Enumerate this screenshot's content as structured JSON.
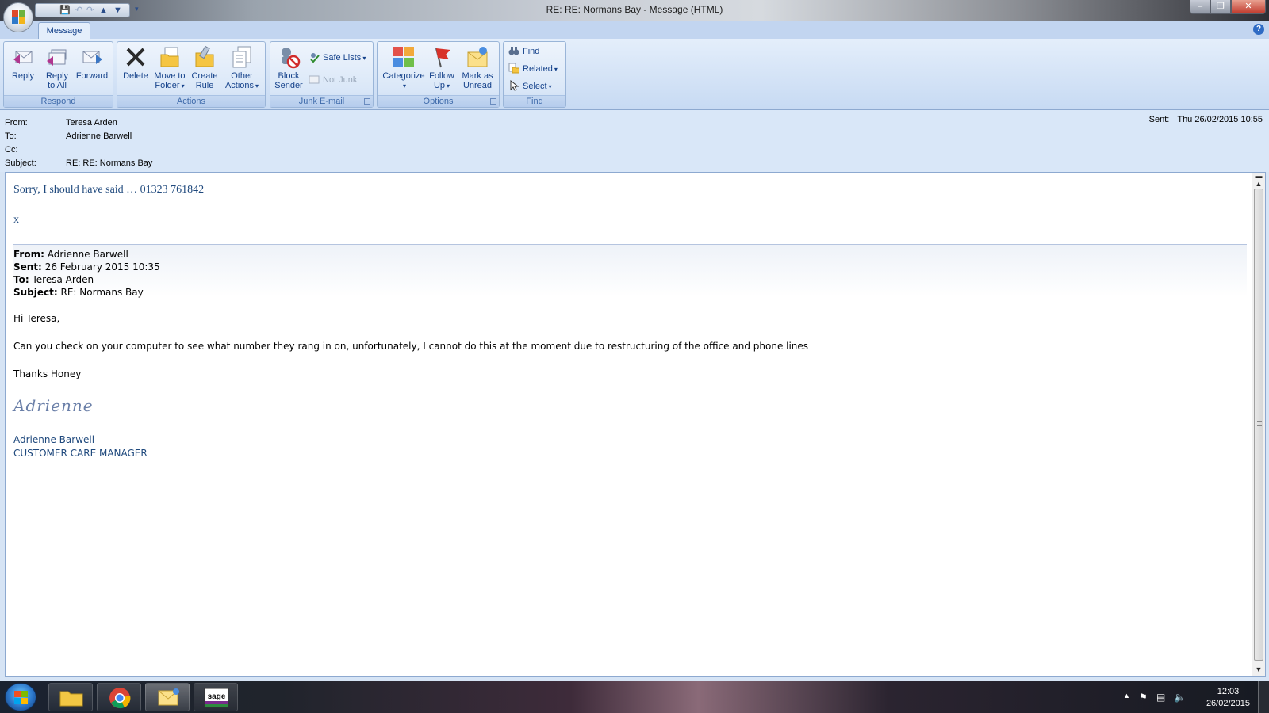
{
  "window": {
    "title": "RE: RE: Normans Bay - Message (HTML)",
    "minimize": "–",
    "maximize": "❐",
    "close": "✕"
  },
  "ribbon": {
    "tab": "Message",
    "help": "?",
    "groups": {
      "respond": {
        "label": "Respond",
        "reply": [
          "Reply",
          ""
        ],
        "reply_all": [
          "Reply",
          "to All"
        ],
        "forward": [
          "Forward",
          ""
        ]
      },
      "actions": {
        "label": "Actions",
        "delete": [
          "Delete",
          ""
        ],
        "move": [
          "Move to",
          "Folder"
        ],
        "rule": [
          "Create",
          "Rule"
        ],
        "other": [
          "Other",
          "Actions"
        ]
      },
      "junk": {
        "label": "Junk E-mail",
        "block": [
          "Block",
          "Sender"
        ],
        "safe_lists": "Safe Lists",
        "not_junk": "Not Junk"
      },
      "options": {
        "label": "Options",
        "categorize": [
          "Categorize",
          ""
        ],
        "follow_up": [
          "Follow",
          "Up"
        ],
        "mark_unread": [
          "Mark as",
          "Unread"
        ]
      },
      "find": {
        "label": "Find",
        "find": "Find",
        "related": "Related",
        "select": "Select"
      }
    }
  },
  "header": {
    "from_label": "From:",
    "from": "Teresa Arden",
    "to_label": "To:",
    "to": "Adrienne Barwell",
    "cc_label": "Cc:",
    "cc": "",
    "subject_label": "Subject:",
    "subject": "RE: RE: Normans Bay",
    "sent_label": "Sent:",
    "sent": "Thu 26/02/2015 10:55"
  },
  "body": {
    "reply_line1": "Sorry, I should have said … 01323 761842",
    "reply_line2": "x",
    "quoted": {
      "from_label": "From:",
      "from": "Adrienne Barwell",
      "sent_label": "Sent:",
      "sent": "26 February 2015 10:35",
      "to_label": "To:",
      "to": "Teresa Arden",
      "subject_label": "Subject:",
      "subject": "RE: Normans Bay"
    },
    "greeting": "Hi Teresa,",
    "paragraph": "Can you check on your computer to see what number they rang in on, unfortunately, I cannot do this at the moment due to restructuring of the office and phone lines",
    "thanks": "Thanks Honey",
    "signature_script": "Adrienne",
    "signature_name": "Adrienne Barwell",
    "signature_title": "CUSTOMER CARE MANAGER"
  },
  "taskbar": {
    "time": "12:03",
    "date": "26/02/2015",
    "sage_label": "sage"
  },
  "colors": {
    "accent": "#15428b",
    "reply_text": "#1f497d"
  }
}
